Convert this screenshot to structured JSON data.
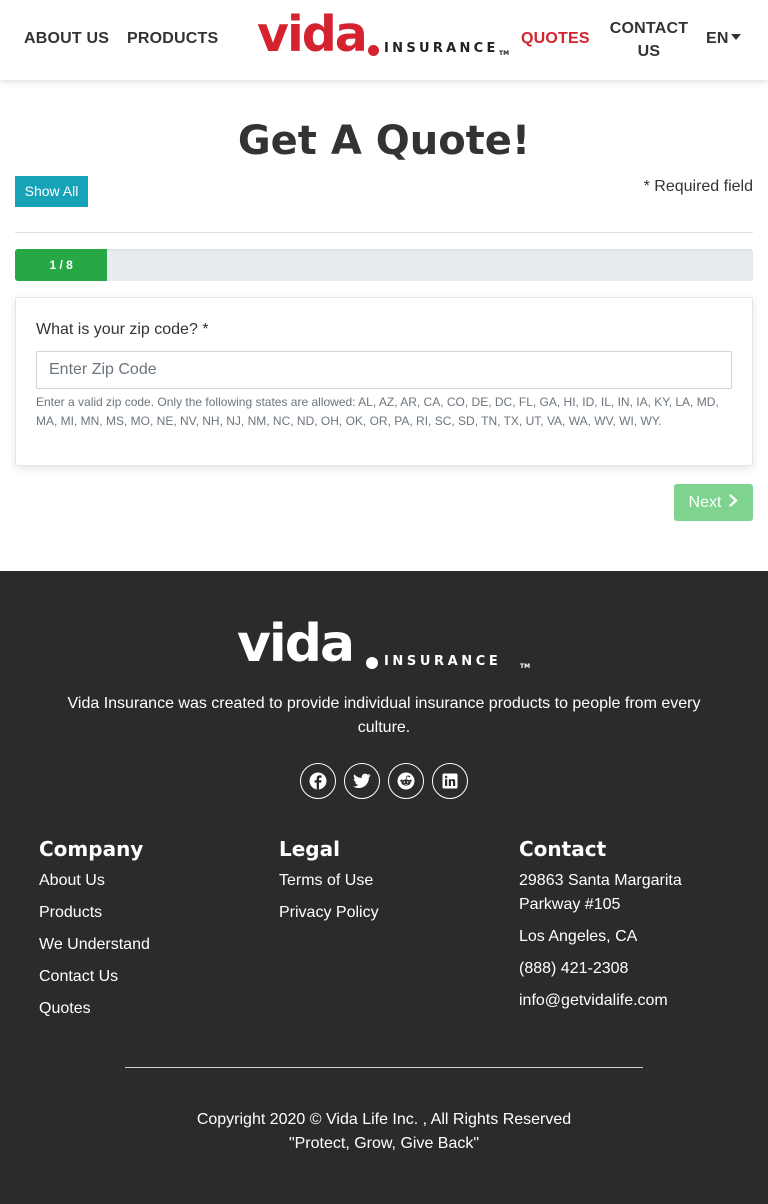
{
  "header": {
    "nav_left": [
      "ABOUT US",
      "PRODUCTS"
    ],
    "nav_right": {
      "quotes": "QUOTES",
      "contact": "CONTACT US",
      "language": "EN"
    },
    "logo": {
      "word": "vida",
      "suffix": "INSURANCE",
      "tm": "TM"
    },
    "colors": {
      "brand_red": "#d4232e",
      "text": "#333333"
    }
  },
  "main": {
    "title": "Get A Quote!",
    "show_all_label": "Show All",
    "required_note": "* Required field",
    "progress": {
      "label": "1 / 8",
      "current": 1,
      "total": 8,
      "color": "#28a745"
    },
    "zip_question": "What is your zip code? *",
    "zip_placeholder": "Enter Zip Code",
    "zip_value": "",
    "help_text": "Enter a valid zip code. Only the following states are allowed: AL, AZ, AR, CA, CO, DE, DC, FL, GA, HI, ID, IL, IN, IA, KY, LA, MD, MA, MI, MN, MS, MO, NE, NV, NH, NJ, NM, NC, ND, OH, OK, OR, PA, RI, SC, SD, TN, TX, UT, VA, WA, WV, WI, WY.",
    "next_label": "Next",
    "next_icon": "chevron-right-icon"
  },
  "footer": {
    "logo": {
      "word": "vida",
      "suffix": "INSURANCE",
      "tm": "TM"
    },
    "tagline": "Vida Insurance was created to provide individual insurance products to people from every culture.",
    "social_icons": [
      "facebook-icon",
      "twitter-icon",
      "reddit-icon",
      "linkedin-icon"
    ],
    "columns": {
      "company": {
        "title": "Company",
        "links": [
          "About Us",
          "Products",
          "We Understand",
          "Contact Us",
          "Quotes"
        ]
      },
      "legal": {
        "title": "Legal",
        "links": [
          "Terms of Use",
          "Privacy Policy"
        ]
      },
      "contact": {
        "title": "Contact",
        "address_line1": "29863 Santa Margarita",
        "address_line2": "Parkway #105",
        "city": "Los Angeles, CA",
        "phone": "(888) 421-2308",
        "email": "info@getvidalife.com"
      }
    },
    "copyright": "Copyright 2020 © Vida Life Inc. , All Rights Reserved",
    "motto": "\"Protect, Grow, Give Back\"",
    "background": "#2b2b2b"
  }
}
